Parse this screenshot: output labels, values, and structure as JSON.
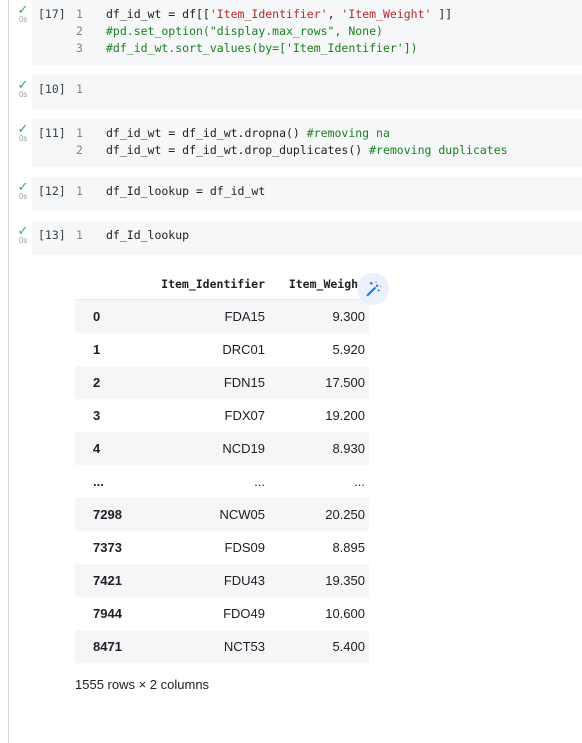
{
  "colors": {
    "accent_blue": "#1a73e8",
    "wand_bg": "#eaf1fd",
    "check_green": "#34a853",
    "string_red": "#b5292f",
    "comment_green": "#1a8020",
    "cell_bg": "#f6f7f8",
    "row_stripe": "#f5f6f7",
    "rule": "#d7d9dc"
  },
  "cells": [
    {
      "prompt": "[17]",
      "status_icon": "check-icon",
      "runtime": "0s",
      "lines": [
        {
          "n": "1",
          "segments": [
            {
              "t": "df_id_wt = df[[",
              "k": "plain"
            },
            {
              "t": "'Item_Identifier'",
              "k": "str"
            },
            {
              "t": ", ",
              "k": "plain"
            },
            {
              "t": "'Item_Weight'",
              "k": "str"
            },
            {
              "t": " ]]",
              "k": "plain"
            }
          ]
        },
        {
          "n": "2",
          "segments": [
            {
              "t": "#pd.set_option(\"display.max_rows\", None)",
              "k": "com"
            }
          ]
        },
        {
          "n": "3",
          "segments": [
            {
              "t": "#df_id_wt.sort_values(by=['Item_Identifier'])",
              "k": "com"
            }
          ]
        }
      ]
    },
    {
      "prompt": "[10]",
      "status_icon": "check-icon",
      "runtime": "0s",
      "lines": [
        {
          "n": "1",
          "segments": [
            {
              "t": "",
              "k": "plain"
            }
          ]
        }
      ]
    },
    {
      "prompt": "[11]",
      "status_icon": "check-icon",
      "runtime": "0s",
      "lines": [
        {
          "n": "1",
          "segments": [
            {
              "t": "df_id_wt = df_id_wt.dropna() ",
              "k": "plain"
            },
            {
              "t": "#removing na",
              "k": "com"
            }
          ]
        },
        {
          "n": "2",
          "segments": [
            {
              "t": "df_id_wt = df_id_wt.drop_duplicates() ",
              "k": "plain"
            },
            {
              "t": "#removing duplicates",
              "k": "com"
            }
          ]
        }
      ]
    },
    {
      "prompt": "[12]",
      "status_icon": "check-icon",
      "runtime": "0s",
      "lines": [
        {
          "n": "1",
          "segments": [
            {
              "t": "df_Id_lookup = df_id_wt",
              "k": "plain"
            }
          ]
        }
      ]
    },
    {
      "prompt": "[13]",
      "status_icon": "check-icon",
      "runtime": "0s",
      "lines": [
        {
          "n": "1",
          "segments": [
            {
              "t": "df_Id_lookup",
              "k": "plain"
            }
          ]
        }
      ]
    }
  ],
  "output": {
    "wand_icon": "magic-wand-icon",
    "table": {
      "index_header": "",
      "columns": [
        "Item_Identifier",
        "Item_Weight"
      ],
      "rows": [
        {
          "index": "0",
          "values": [
            "FDA15",
            "9.300"
          ]
        },
        {
          "index": "1",
          "values": [
            "DRC01",
            "5.920"
          ]
        },
        {
          "index": "2",
          "values": [
            "FDN15",
            "17.500"
          ]
        },
        {
          "index": "3",
          "values": [
            "FDX07",
            "19.200"
          ]
        },
        {
          "index": "4",
          "values": [
            "NCD19",
            "8.930"
          ]
        },
        {
          "index": "...",
          "values": [
            "...",
            "..."
          ],
          "ellipsis": true
        },
        {
          "index": "7298",
          "values": [
            "NCW05",
            "20.250"
          ]
        },
        {
          "index": "7373",
          "values": [
            "FDS09",
            "8.895"
          ]
        },
        {
          "index": "7421",
          "values": [
            "FDU43",
            "19.350"
          ]
        },
        {
          "index": "7944",
          "values": [
            "FDO49",
            "10.600"
          ]
        },
        {
          "index": "8471",
          "values": [
            "NCT53",
            "5.400"
          ]
        }
      ],
      "footer": "1555 rows × 2 columns"
    }
  }
}
